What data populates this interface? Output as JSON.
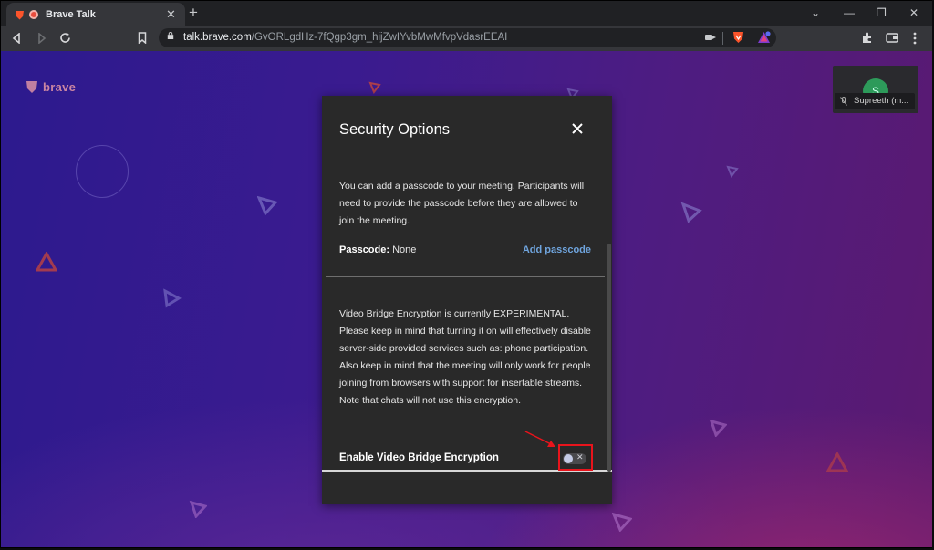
{
  "browser": {
    "tab_title": "Brave Talk",
    "tab_close": "✕",
    "new_tab": "+",
    "url_host": "talk.brave.com",
    "url_path": "/GvORLgdHz-7fQgp3gm_hijZwIYvbMwMfvpVdasrEEAI",
    "window_controls": [
      "⌄",
      "—",
      "❐",
      "✕"
    ],
    "nav_icons": [
      "back-icon",
      "forward-icon",
      "reload-icon",
      "bookmark-icon"
    ],
    "toolbar_icons": [
      "extensions-icon",
      "wallet-icon",
      "menu-icon"
    ]
  },
  "page": {
    "logo_text": "brave",
    "participant": {
      "initial": "S",
      "name": "Supreeth (m..."
    }
  },
  "modal": {
    "title": "Security Options",
    "passcode_description": "You can add a passcode to your meeting. Participants will need to provide the passcode before they are allowed to join the meeting.",
    "passcode_label": "Passcode:",
    "passcode_value": "None",
    "add_passcode": "Add passcode",
    "encryption_description": "Video Bridge Encryption is currently EXPERIMENTAL. Please keep in mind that turning it on will effectively disable server-side provided services such as: phone participation. Also keep in mind that the meeting will only work for people joining from browsers with support for insertable streams. Note that chats will not use this encryption.",
    "encryption_label": "Enable Video Bridge Encryption",
    "encryption_enabled": false,
    "toggle_off_glyph": "✕"
  },
  "colors": {
    "accent_link": "#6fa4dd",
    "highlight_red": "#e8141c",
    "modal_bg": "#292929"
  }
}
